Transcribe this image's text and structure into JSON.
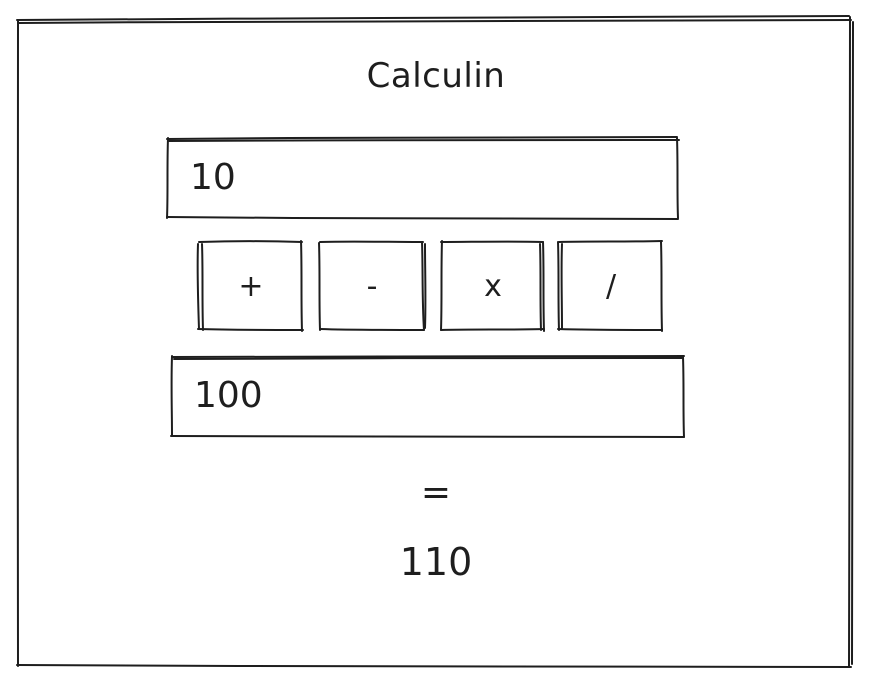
{
  "app": {
    "title": "Calculin"
  },
  "inputs": {
    "first_value": "10",
    "second_value": "100"
  },
  "operators": {
    "plus": "+",
    "minus": "-",
    "times": "x",
    "divide": "/"
  },
  "equals": "=",
  "result": "110",
  "colors": {
    "stroke": "#1e1e1e",
    "background": "#ffffff"
  }
}
